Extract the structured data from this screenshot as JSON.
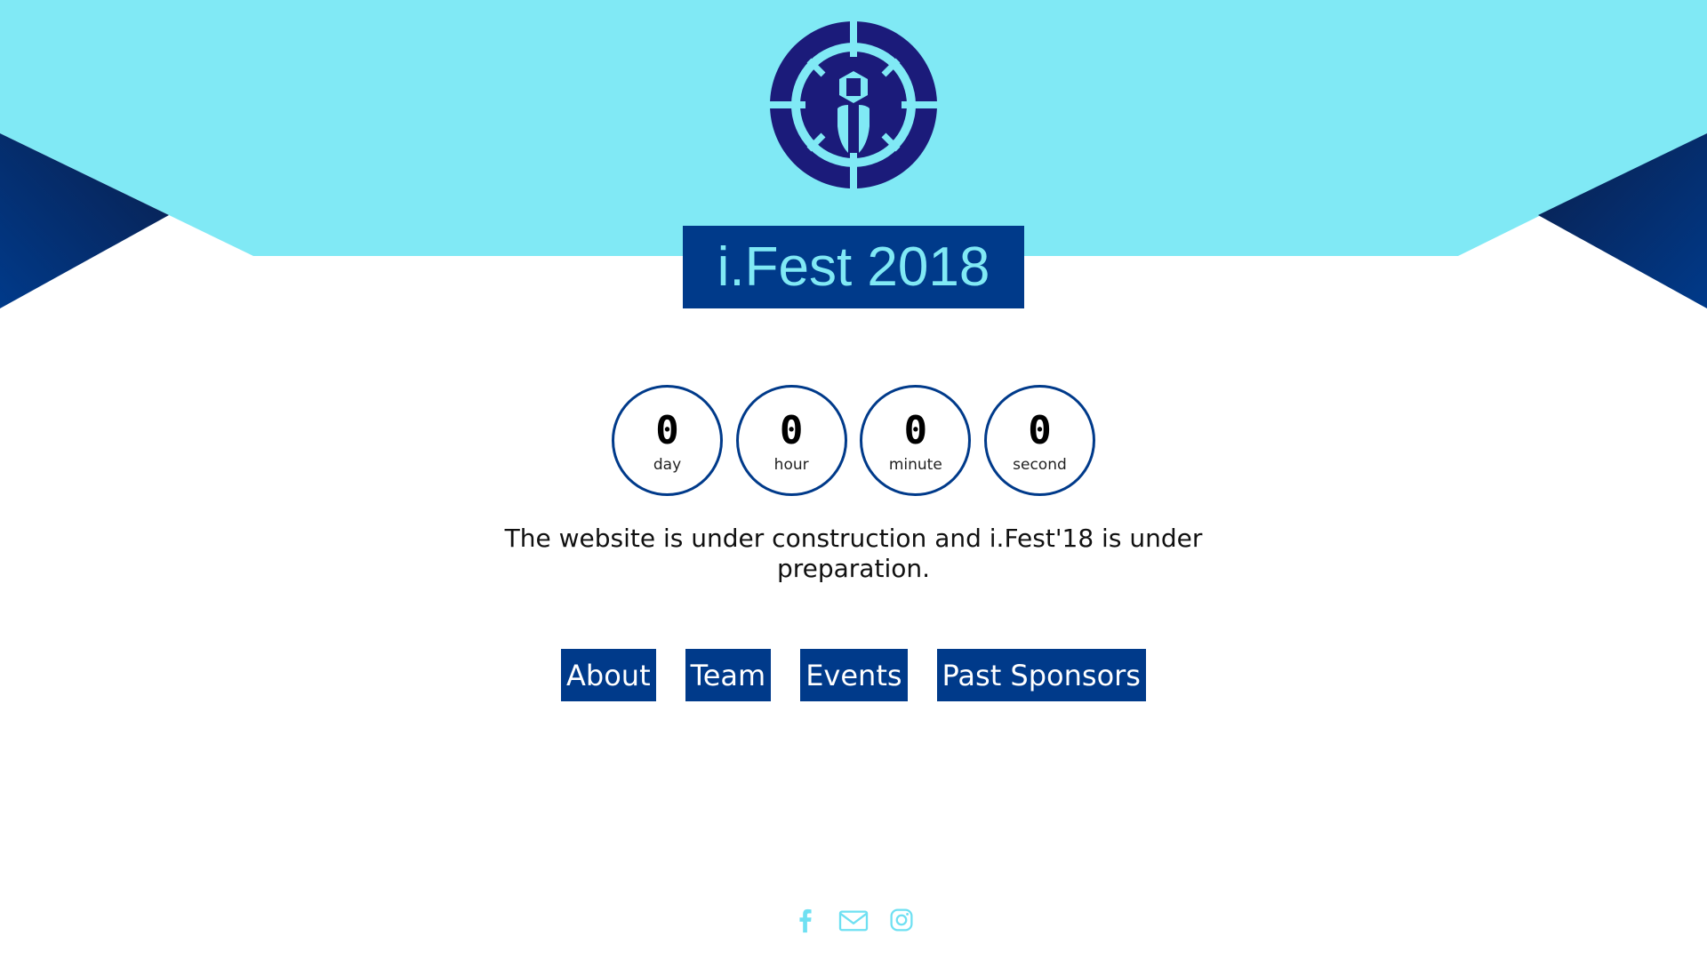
{
  "colors": {
    "light_blue": "#80e9f5",
    "navy": "#003a8a",
    "dark_navy": "#0a1f5c",
    "logo_navy": "#1b1b7a",
    "title_text": "#80e9f5",
    "social_icon": "#6fe0f2"
  },
  "logo": {
    "icon": "ifest-logo-icon"
  },
  "header": {
    "title": "i.Fest 2018"
  },
  "countdown": [
    {
      "value": "0",
      "unit": "day"
    },
    {
      "value": "0",
      "unit": "hour"
    },
    {
      "value": "0",
      "unit": "minute"
    },
    {
      "value": "0",
      "unit": "second"
    }
  ],
  "message": "The website is under construction and i.Fest'18 is under preparation.",
  "nav": {
    "about": "About",
    "team": "Team",
    "events": "Events",
    "past_sponsors": "Past Sponsors"
  },
  "social": [
    {
      "icon": "facebook-icon"
    },
    {
      "icon": "email-icon"
    },
    {
      "icon": "instagram-icon"
    }
  ]
}
